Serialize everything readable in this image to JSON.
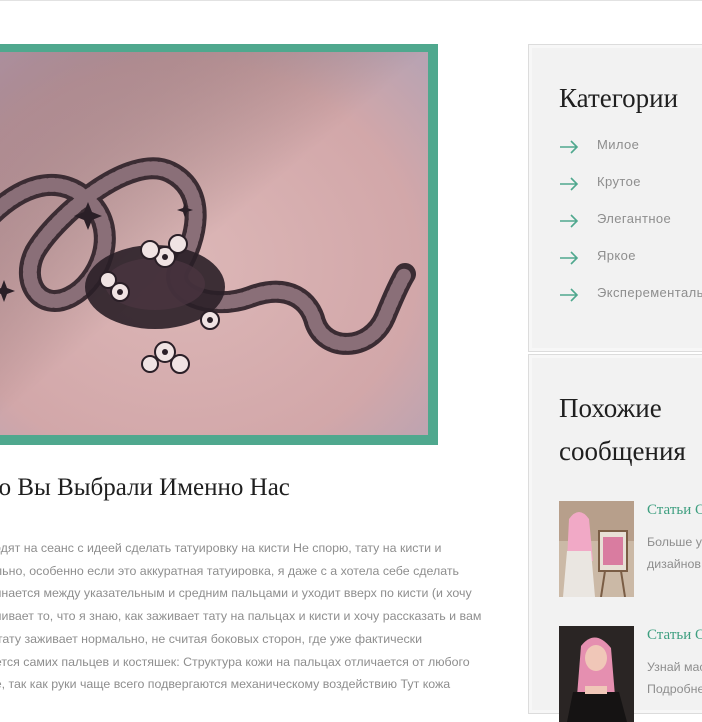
{
  "article": {
    "title": "то Вы Выбрали Именно Нас",
    "body_lines": [
      "ходят на сеанс с идеей сделать татуировку на кисти Не спорю, тату на кисти и",
      "ильно, особенно если это аккуратная татуировка, я даже с а хотела себе сделать",
      "чинается между указательным и средним пальцами и уходит вверх по кисти (и хочу",
      "вливает то, что я знаю, как заживает тату на пальцах и кисти и хочу рассказать и вам",
      "к тату заживает нормально, не считая боковых сторон, где уже фактически",
      "ается самих пальцев и костяшек: Структура кожи на пальцах отличается от любого",
      "пе, так как руки чаще всего подвергаются механическому воздействию Тут кожа"
    ]
  },
  "sidebar": {
    "categories": {
      "title": "Категории",
      "items": [
        {
          "label": "Милое"
        },
        {
          "label": "Крутое"
        },
        {
          "label": "Элегантное"
        },
        {
          "label": "Яркое"
        },
        {
          "label": "Эксперементальное"
        }
      ]
    },
    "related": {
      "title_line1": "Похожие",
      "title_line2": "сообщения",
      "posts": [
        {
          "category": "Статьи О",
          "line1": "Больше у",
          "line2": "дизайнов"
        },
        {
          "category": "Статьи О",
          "line1": "Узнай мас",
          "line2": "Подробне"
        }
      ]
    }
  },
  "colors": {
    "accent": "#4fa88e",
    "link": "#3e9f80",
    "muted_text": "#8e8e8e",
    "widget_bg": "#f2f2f2"
  },
  "icons": {
    "category_bullet": "arrow-right-icon"
  }
}
